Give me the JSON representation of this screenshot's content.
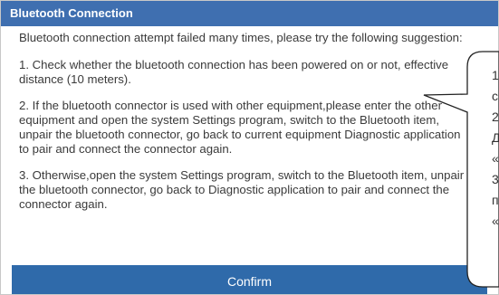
{
  "dialog": {
    "title": "Bluetooth Connection",
    "intro": "Bluetooth connection attempt failed many times, please try the following suggestion:",
    "items": [
      "1. Check whether the bluetooth connection has been powered on or not, effective distance (10 meters).",
      "2. If the bluetooth connector is used with other equipment,please enter the other equipment and open the system Settings program, switch to the Bluetooth item, unpair the bluetooth connector, go back to current equipment Diagnostic application to pair and connect the connector again.",
      "3. Otherwise,open the system Settings program, switch to the Bluetooth item, unpair the bluetooth connector, go back to Diagnostic application to pair and connect the connector again."
    ],
    "confirm_label": "Confirm"
  },
  "callout": {
    "lines": [
      "1",
      "c",
      "2",
      "Д",
      "«",
      "3",
      "п",
      "«"
    ]
  },
  "colors": {
    "title_bar": "#3f6fb0",
    "confirm_button": "#2f6aaa",
    "callout_border": "#222222"
  }
}
